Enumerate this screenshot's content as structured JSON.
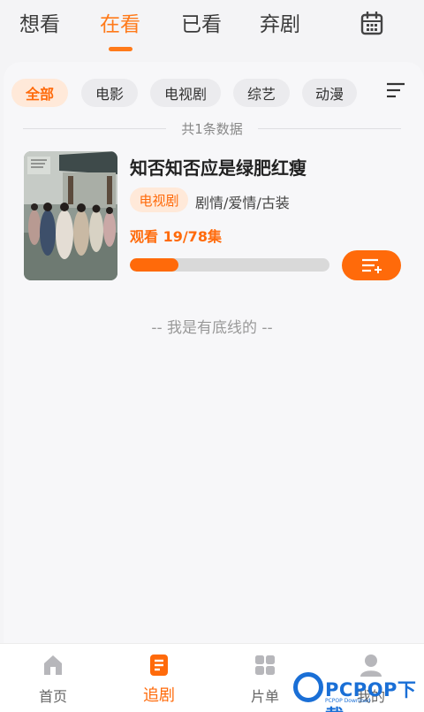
{
  "top_tabs": [
    {
      "label": "想看"
    },
    {
      "label": "在看",
      "active": true
    },
    {
      "label": "已看"
    },
    {
      "label": "弃剧"
    }
  ],
  "filters": {
    "chips": [
      "全部",
      "电影",
      "电视剧",
      "综艺",
      "动漫"
    ],
    "selected": "全部"
  },
  "count_text": "共1条数据",
  "show": {
    "title": "知否知否应是绿肥红瘦",
    "type_tag": "电视剧",
    "genres": "剧情/爱情/古装",
    "progress_label": "观看 19/78集",
    "episodes_watched": 19,
    "episodes_total": 78
  },
  "end_text": "-- 我是有底线的 --",
  "bottom_nav": [
    {
      "label": "首页",
      "icon": "home-icon"
    },
    {
      "label": "追剧",
      "icon": "follow-icon",
      "active": true
    },
    {
      "label": "片单",
      "icon": "grid-icon"
    },
    {
      "label": "我的",
      "icon": "user-icon"
    }
  ],
  "watermark": {
    "text": "PCPOP下载",
    "sub": "PCPOP Download"
  },
  "colors": {
    "accent": "#ff6a0a",
    "accent_light": "#ffe9d9",
    "text": "#333333",
    "muted": "#999999"
  }
}
